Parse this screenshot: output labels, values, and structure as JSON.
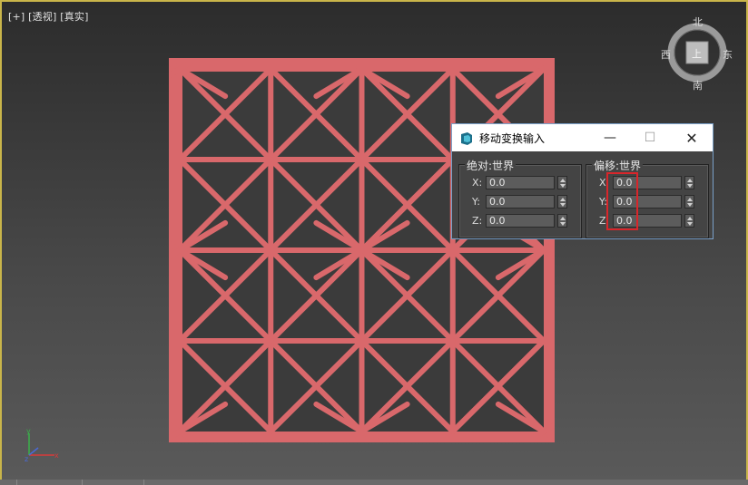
{
  "viewport": {
    "label_plus": "[+]",
    "label_view": "[透视]",
    "label_shading": "[真实]"
  },
  "viewcube": {
    "north": "北",
    "south": "南",
    "east": "东",
    "west": "西",
    "face": "上"
  },
  "dialog": {
    "title": "移动变换输入",
    "minimize": "—",
    "maximize": "☐",
    "close": "✕",
    "absolute": {
      "title": "绝对:世界",
      "rows": [
        {
          "label": "X:",
          "value": "0.0"
        },
        {
          "label": "Y:",
          "value": "0.0"
        },
        {
          "label": "Z:",
          "value": "0.0"
        }
      ]
    },
    "offset": {
      "title": "偏移:世界",
      "rows": [
        {
          "label": "X:",
          "value": "0.0"
        },
        {
          "label": "Y:",
          "value": "0.0"
        },
        {
          "label": "Z:",
          "value": "0.0"
        }
      ]
    }
  },
  "colors": {
    "panel": "#d9686b",
    "highlight": "#d8262b",
    "viewport_border": "#c9b54a"
  },
  "axis_tripod": {
    "x": "x",
    "y": "y",
    "z": "z"
  }
}
